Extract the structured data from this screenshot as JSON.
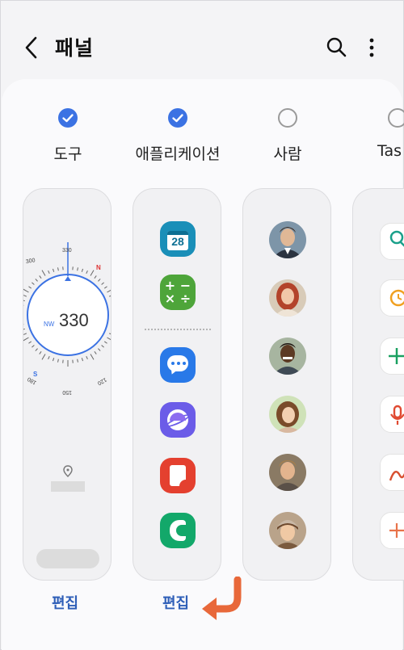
{
  "header": {
    "title": "패널"
  },
  "tabs": [
    {
      "label": "도구",
      "checked": true
    },
    {
      "label": "애플리케이션",
      "checked": true
    },
    {
      "label": "사람",
      "checked": false
    },
    {
      "label": "Tas",
      "checked": false
    }
  ],
  "compass": {
    "heading": "330",
    "direction": "NW",
    "ticks": [
      "300",
      "330",
      "N",
      "S",
      "150",
      "120",
      "180"
    ]
  },
  "apps": {
    "calendar_date": "28",
    "items": [
      "calendar-icon",
      "calculator-icon",
      "messages-icon",
      "internet-icon",
      "notes-icon",
      "phone-icon"
    ]
  },
  "people": {
    "count": 6
  },
  "edit_buttons": [
    "편집",
    "편집"
  ],
  "colors": {
    "accent": "#3b72e3",
    "edit": "#2f5fb8",
    "arrow": "#e8683a"
  }
}
